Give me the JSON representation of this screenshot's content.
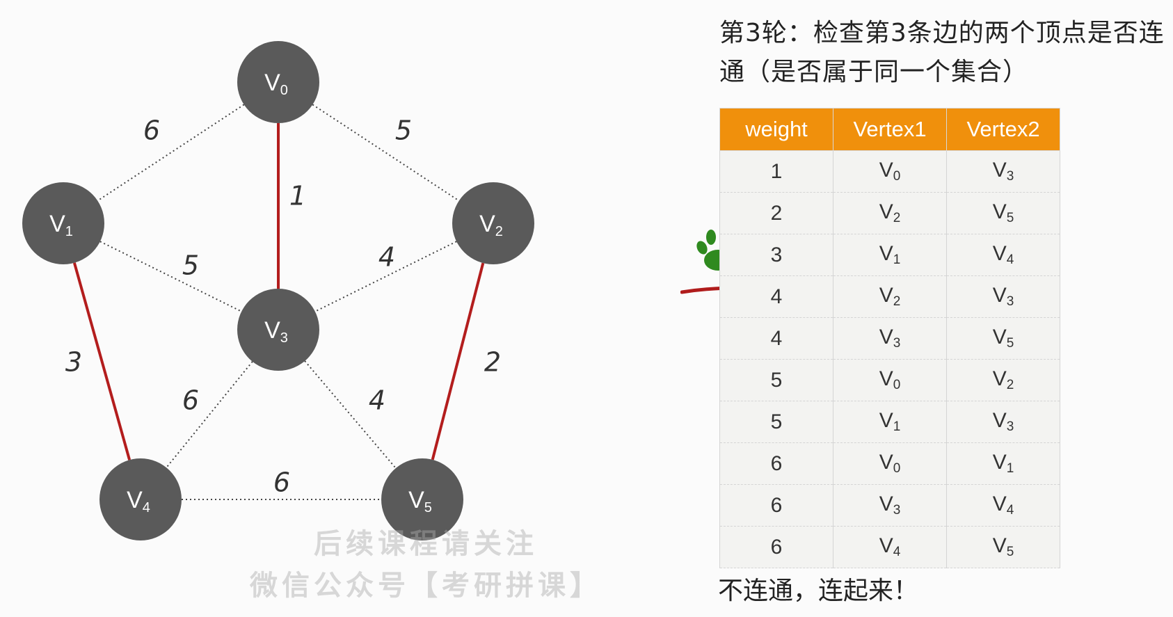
{
  "heading": "第3轮：检查第3条边的两个顶点是否连通（是否属于同一个集合）",
  "graph": {
    "vertices": [
      {
        "id": "V0",
        "main": "V",
        "sub": "0"
      },
      {
        "id": "V1",
        "main": "V",
        "sub": "1"
      },
      {
        "id": "V2",
        "main": "V",
        "sub": "2"
      },
      {
        "id": "V3",
        "main": "V",
        "sub": "3"
      },
      {
        "id": "V4",
        "main": "V",
        "sub": "4"
      },
      {
        "id": "V5",
        "main": "V",
        "sub": "5"
      }
    ],
    "edges": [
      {
        "from": "V0",
        "to": "V1",
        "weight": "6",
        "selected": false
      },
      {
        "from": "V0",
        "to": "V2",
        "weight": "5",
        "selected": false
      },
      {
        "from": "V0",
        "to": "V3",
        "weight": "1",
        "selected": true
      },
      {
        "from": "V1",
        "to": "V3",
        "weight": "5",
        "selected": false
      },
      {
        "from": "V2",
        "to": "V3",
        "weight": "4",
        "selected": false
      },
      {
        "from": "V1",
        "to": "V4",
        "weight": "3",
        "selected": true
      },
      {
        "from": "V2",
        "to": "V5",
        "weight": "2",
        "selected": true
      },
      {
        "from": "V3",
        "to": "V4",
        "weight": "6",
        "selected": false
      },
      {
        "from": "V3",
        "to": "V5",
        "weight": "4",
        "selected": false
      },
      {
        "from": "V4",
        "to": "V5",
        "weight": "6",
        "selected": false
      }
    ],
    "colors": {
      "node": "#5a5a5a",
      "selected_edge": "#b31d1d",
      "dotted_edge": "#444444"
    }
  },
  "table": {
    "headers": [
      "weight",
      "Vertex1",
      "Vertex2"
    ],
    "rows": [
      {
        "weight": "1",
        "v1": "V",
        "v1sub": "0",
        "v2": "V",
        "v2sub": "3"
      },
      {
        "weight": "2",
        "v1": "V",
        "v1sub": "2",
        "v2": "V",
        "v2sub": "5"
      },
      {
        "weight": "3",
        "v1": "V",
        "v1sub": "1",
        "v2": "V",
        "v2sub": "4"
      },
      {
        "weight": "4",
        "v1": "V",
        "v1sub": "2",
        "v2": "V",
        "v2sub": "3"
      },
      {
        "weight": "4",
        "v1": "V",
        "v1sub": "3",
        "v2": "V",
        "v2sub": "5"
      },
      {
        "weight": "5",
        "v1": "V",
        "v1sub": "0",
        "v2": "V",
        "v2sub": "2"
      },
      {
        "weight": "5",
        "v1": "V",
        "v1sub": "1",
        "v2": "V",
        "v2sub": "3"
      },
      {
        "weight": "6",
        "v1": "V",
        "v1sub": "0",
        "v2": "V",
        "v2sub": "1"
      },
      {
        "weight": "6",
        "v1": "V",
        "v1sub": "3",
        "v2": "V",
        "v2sub": "4"
      },
      {
        "weight": "6",
        "v1": "V",
        "v1sub": "4",
        "v2": "V",
        "v2sub": "5"
      }
    ],
    "header_color": "#f0900c",
    "current_row": 3
  },
  "conclusion": "不连通，连起来！",
  "watermark": {
    "line1": "后续课程请关注",
    "line2": "微信公众号【考研拼课】"
  },
  "icons": {
    "pointer": "paw-icon"
  }
}
